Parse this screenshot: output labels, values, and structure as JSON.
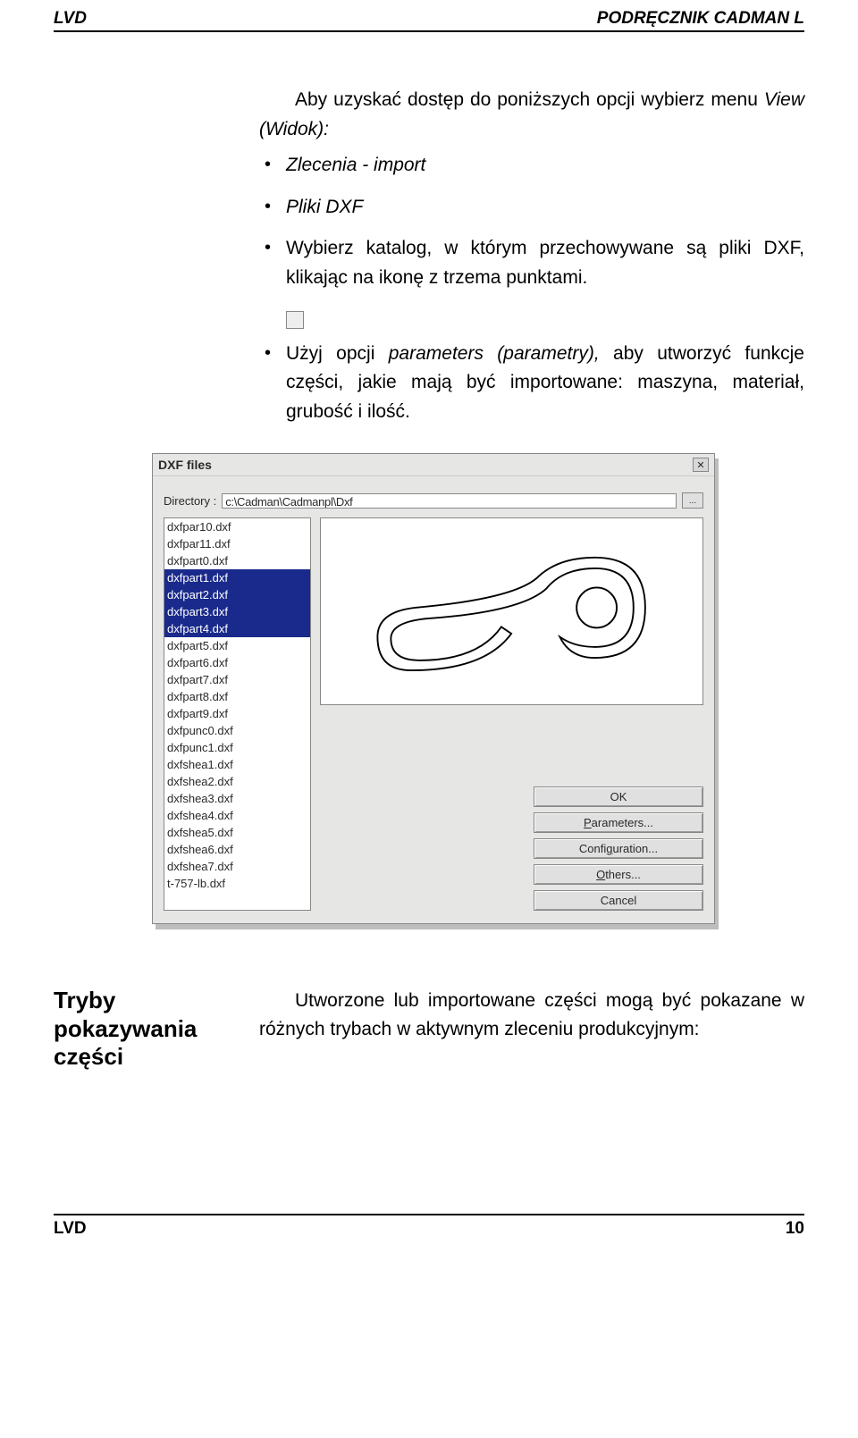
{
  "header": {
    "left": "LVD",
    "right": "PODRĘCZNIK CADMAN L"
  },
  "intro": "Aby uzyskać dostęp do poniższych opcji wybierz menu",
  "intro_em": "View (Widok):",
  "bullets": {
    "b1_em": "Zlecenia - import",
    "b2_em": "Pliki DXF",
    "b3_pre": "Wybierz katalog, w którym przechowywane są pliki DXF, klikając na ikonę z trzema punktami.",
    "b4_pre": "Użyj opcji ",
    "b4_em": "parameters (parametry),",
    "b4_post": " aby utworzyć funkcje części, jakie mają być importowane: maszyna, materiał, grubość i ilość."
  },
  "dialog": {
    "title": "DXF files",
    "close_aria": "Close",
    "dir_label": "Directory :",
    "dir_value": "c:\\Cadman\\Cadmanpl\\Dxf",
    "browse": "...",
    "files": [
      "dxfpar10.dxf",
      "dxfpar11.dxf",
      "dxfpart0.dxf",
      "dxfpart1.dxf",
      "dxfpart2.dxf",
      "dxfpart3.dxf",
      "dxfpart4.dxf",
      "dxfpart5.dxf",
      "dxfpart6.dxf",
      "dxfpart7.dxf",
      "dxfpart8.dxf",
      "dxfpart9.dxf",
      "dxfpunc0.dxf",
      "dxfpunc1.dxf",
      "dxfshea1.dxf",
      "dxfshea2.dxf",
      "dxfshea3.dxf",
      "dxfshea4.dxf",
      "dxfshea5.dxf",
      "dxfshea6.dxf",
      "dxfshea7.dxf",
      "t-757-lb.dxf"
    ],
    "selected": [
      3,
      4,
      5,
      6
    ],
    "buttons": {
      "ok": "OK",
      "params": "Parameters...",
      "config": "Configuration...",
      "others": "Others...",
      "cancel": "Cancel"
    }
  },
  "section": {
    "label": "Tryby pokazywania części",
    "text": "Utworzone lub importowane części mogą być pokazane w różnych trybach w aktywnym zleceniu produkcyjnym:"
  },
  "footer": {
    "left": "LVD",
    "right": "10"
  }
}
